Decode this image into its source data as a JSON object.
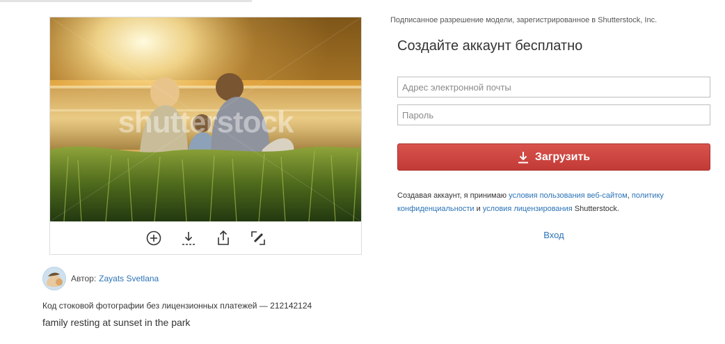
{
  "image": {
    "watermark": "shutterstock",
    "toolbar": [
      {
        "name": "add",
        "icon": "plus-circle-icon"
      },
      {
        "name": "download",
        "icon": "download-icon"
      },
      {
        "name": "share",
        "icon": "share-icon"
      },
      {
        "name": "edit",
        "icon": "edit-icon"
      }
    ]
  },
  "author": {
    "prefix": "Автор:",
    "name": "Zayats Svetlana"
  },
  "photo": {
    "code_text": "Код стоковой фотографии без лицензионных платежей — 212142124",
    "title": "family resting at sunset in the park"
  },
  "signup": {
    "release_note": "Подписанное разрешение модели, зарегистрированное в Shutterstock, Inc.",
    "heading": "Создайте аккаунт бесплатно",
    "email": {
      "value": "",
      "placeholder": "Адрес электронной почты"
    },
    "password": {
      "value": "",
      "placeholder": "Пароль"
    },
    "submit_label": "Загрузить",
    "submit_icon": "download-icon",
    "legal": {
      "prefix": "Создавая аккаунт, я принимаю ",
      "terms_link": "условия пользования веб-сайтом",
      "sep": ", ",
      "privacy_link": "политику конфиденциальности",
      "and": " и ",
      "license_link": "условия лицензирования",
      "suffix": " Shutterstock."
    },
    "login_label": "Вход"
  },
  "colors": {
    "accent_red": "#c9413c",
    "link_blue": "#2b73b6",
    "border_gray": "#bdbdbd"
  }
}
